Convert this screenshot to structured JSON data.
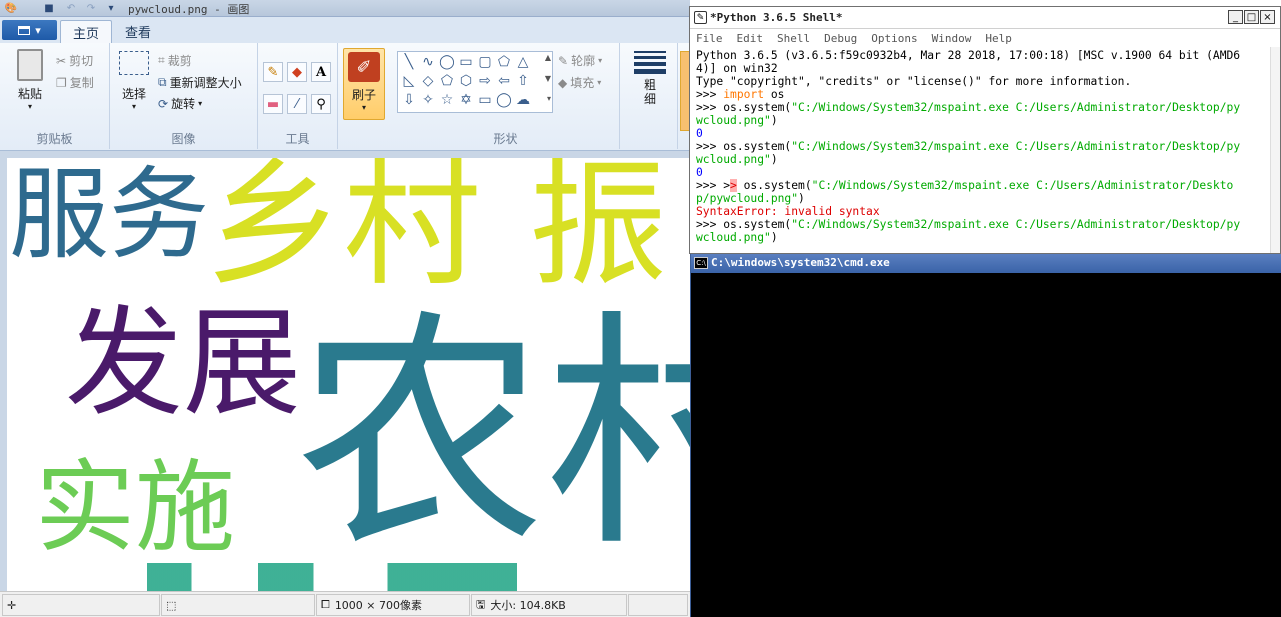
{
  "paint": {
    "title": "pywcloud.png - 画图",
    "file_menu_label": "",
    "tabs": [
      "主页",
      "查看"
    ],
    "groups": {
      "clipboard": {
        "label": "剪贴板",
        "paste": "粘贴",
        "cut": "剪切",
        "copy": "复制"
      },
      "image": {
        "label": "图像",
        "select": "选择",
        "crop": "裁剪",
        "resize": "重新调整大小",
        "rotate": "旋转"
      },
      "tools": {
        "label": "工具"
      },
      "brushes": {
        "label": "刷子"
      },
      "shapes": {
        "label": "形状",
        "outline": "轮廓",
        "fill": "填充"
      },
      "size": {
        "label": "粗\n细"
      }
    },
    "canvas_words": [
      {
        "text": "服务",
        "color": "#2e6a8e"
      },
      {
        "text": "乡村",
        "color": "#d8e024"
      },
      {
        "text": "振",
        "color": "#d8e024"
      },
      {
        "text": "发展",
        "color": "#4a1a6a"
      },
      {
        "text": "农村",
        "color": "#2a7a8e"
      },
      {
        "text": "实施",
        "color": "#6ccc55"
      }
    ],
    "status": {
      "dimensions": "1000 × 700像素",
      "size": "大小: 104.8KB"
    }
  },
  "python_shell": {
    "title": "*Python 3.6.5 Shell*",
    "menu": [
      "File",
      "Edit",
      "Shell",
      "Debug",
      "Options",
      "Window",
      "Help"
    ],
    "lines": {
      "l1": "Python 3.6.5 (v3.6.5:f59c0932b4, Mar 28 2018, 17:00:18) [MSC v.1900 64 bit (AMD6",
      "l2": "4)] on win32",
      "l3": "Type \"copyright\", \"credits\" or \"license()\" for more information.",
      "l4_prompt": ">>> ",
      "l4_kw": "import",
      "l4_rest": " os",
      "l5_prompt": ">>> ",
      "l5_code": "os.system(",
      "l5_str": "\"C:/Windows/System32/mspaint.exe C:/Users/Administrator/Desktop/py",
      "l6_str": "wcloud.png\"",
      "l6_rest": ")",
      "l7_out": "0",
      "l8_prompt": ">>> ",
      "l8_code": "os.system(",
      "l8_str": "\"C:/Windows/System32/mspaint.exe C:/Users/Administrator/Desktop/py",
      "l9_str": "wcloud.png\"",
      "l9_rest": ")",
      "l10_out": "0",
      "l11_prompt": ">>> >",
      "l11_err": ">",
      "l11_code": " os.system(",
      "l11_str": "\"C:/Windows/System32/mspaint.exe C:/Users/Administrator/Deskto",
      "l12_str": "p/pywcloud.png\"",
      "l12_rest": ")",
      "l13_err": "SyntaxError: invalid syntax",
      "l14_prompt": ">>> ",
      "l14_code": "os.system(",
      "l14_str": "\"C:/Windows/System32/mspaint.exe C:/Users/Administrator/Desktop/py",
      "l15_str": "wcloud.png\"",
      "l15_rest": ")"
    }
  },
  "cmd": {
    "title": "C:\\windows\\system32\\cmd.exe",
    "icon_text": "C:\\"
  }
}
